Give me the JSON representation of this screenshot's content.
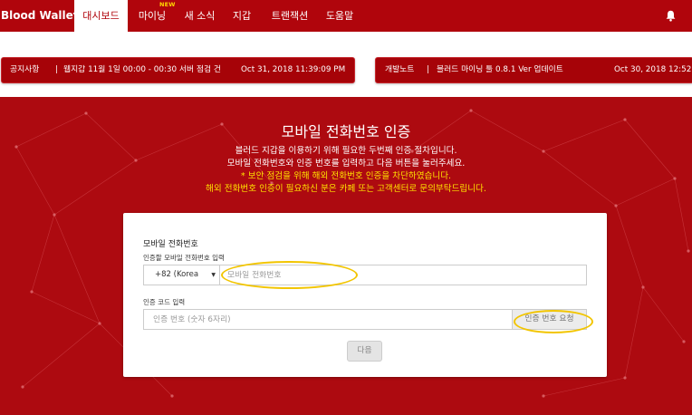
{
  "nav": {
    "brand": "Blood Wallet",
    "tabs": [
      {
        "label": "대시보드",
        "active": true
      },
      {
        "label": "마이닝",
        "badge": "NEW"
      },
      {
        "label": "새 소식"
      },
      {
        "label": "지갑"
      },
      {
        "label": "트랜잭션"
      },
      {
        "label": "도움말"
      }
    ],
    "bell_icon": "bell-icon"
  },
  "notices": [
    {
      "category": "공지사항",
      "separator": "|",
      "text": "웹지갑 11월 1일 00:00 - 00:30 서버 점검 건",
      "date": "Oct 31, 2018 11:39:09 PM"
    },
    {
      "category": "개발노트",
      "separator": "|",
      "text": "블러드 마이닝 툴 0.8.1 Ver 업데이트",
      "date": "Oct 30, 2018 12:52"
    }
  ],
  "hero": {
    "title": "모바일 전화번호 인증",
    "lines": [
      "블러드 지갑을 이용하기 위해 필요한 두번째 인증 절차입니다.",
      "모바일 전화번호와 인증 번호를 입력하고 다음 버튼을 눌러주세요.",
      "* 보안 점검을 위해 해외 전화번호 인증을 차단하였습니다.",
      "해외 전화번호 인증이 필요하신 분은 카페 또는 고객센터로 문의부탁드립니다."
    ]
  },
  "form": {
    "section_title": "모바일 전화번호",
    "phone_label": "인증할 모바일 전화번호 입력",
    "country_value": "+82 (Korea",
    "phone_placeholder": "모바일 전화번호",
    "code_label": "인증 코드 입력",
    "code_placeholder": "인증 번호 (숫자 6자리)",
    "request_button": "인증 번호 요청",
    "next_button": "다음"
  },
  "colors": {
    "brand_red": "#b0050c",
    "hero_red": "#ad0a10",
    "warning_yellow": "#ffe200",
    "highlight_yellow": "#f2c500"
  }
}
